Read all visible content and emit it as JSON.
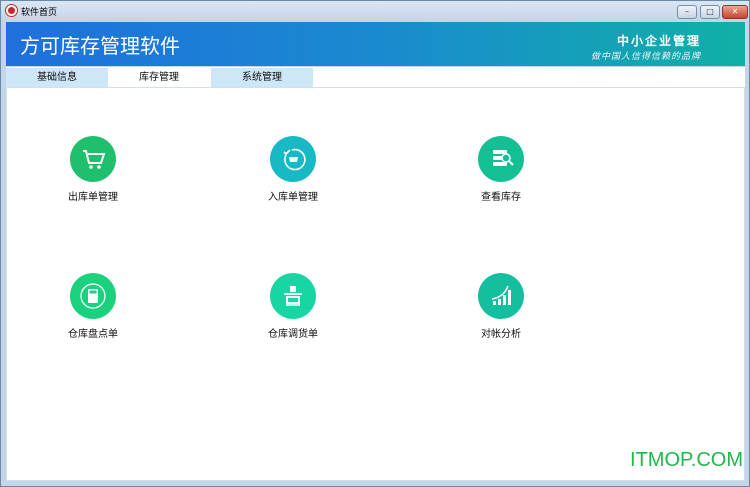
{
  "window": {
    "title": "软件首页",
    "controls": [
      "minimize",
      "maximize",
      "close"
    ]
  },
  "header": {
    "title": "方可库存管理软件",
    "slogan_main": "中小企业管理",
    "slogan_sub": "做中国人信得信赖的品牌"
  },
  "tabs": [
    {
      "label": "基础信息"
    },
    {
      "label": "库存管理",
      "active": true
    },
    {
      "label": "系统管理"
    }
  ],
  "tiles": [
    {
      "label": "出库单管理",
      "icon": "shopping-cart-icon",
      "color": "#1fbf6e"
    },
    {
      "label": "入库单管理",
      "icon": "cart-refresh-icon",
      "color": "#17b9c4"
    },
    {
      "label": "查看库存",
      "icon": "database-search-icon",
      "color": "#15bf94"
    },
    {
      "label": "仓库盘点单",
      "icon": "calculator-icon",
      "color": "#1ad27e"
    },
    {
      "label": "仓库调货单",
      "icon": "transfer-icon",
      "color": "#18d6a4"
    },
    {
      "label": "对帐分析",
      "icon": "growth-chart-icon",
      "color": "#14bfa0"
    }
  ],
  "watermark": "ITMOP.COM"
}
